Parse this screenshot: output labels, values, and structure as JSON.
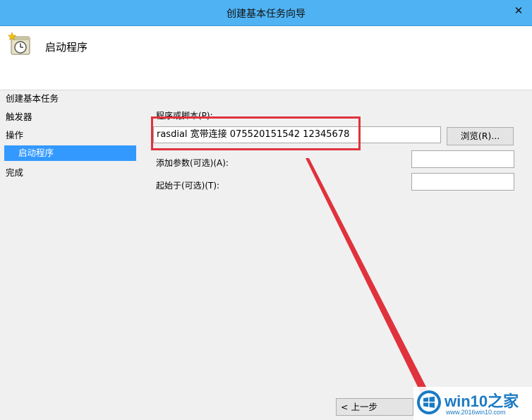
{
  "window": {
    "title": "创建基本任务向导",
    "close_glyph": "✕"
  },
  "header": {
    "title": "启动程序",
    "icon": "scheduled-task-clock-icon"
  },
  "steps": [
    {
      "label": "创建基本任务"
    },
    {
      "label": "触发器"
    },
    {
      "label": "操作"
    },
    {
      "label": "启动程序"
    },
    {
      "label": "完成"
    }
  ],
  "form": {
    "program_label": "程序或脚本(P):",
    "program_value": "rasdial 宽带连接 075520151542 12345678",
    "browse_label": "浏览(R)...",
    "args_label": "添加参数(可选)(A):",
    "args_value": "",
    "start_in_label": "起始于(可选)(T):",
    "start_in_value": ""
  },
  "footer": {
    "back_label": "< 上一步"
  },
  "annotation": {
    "highlight_color": "#e0323c"
  },
  "watermark": {
    "brand": "win10之家",
    "url": "www.2016win10.com"
  },
  "colors": {
    "titlebar": "#4fb2f2",
    "selected_step": "#3399ff"
  }
}
